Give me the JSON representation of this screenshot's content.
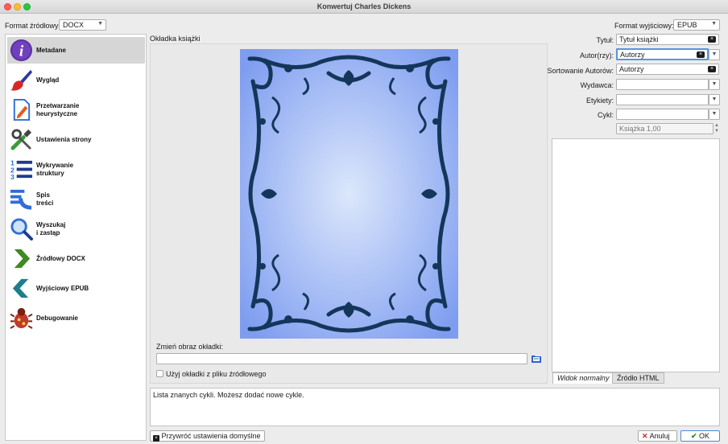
{
  "window": {
    "title": "Konwertuj Charles Dickens"
  },
  "source_format": {
    "label": "Format źródłowy:",
    "value": "DOCX"
  },
  "output_format": {
    "label": "Format wyjściowy:",
    "value": "EPUB"
  },
  "sidebar": {
    "items": [
      {
        "label": "Metadane",
        "icon": "info-icon",
        "active": true
      },
      {
        "label": "Wygląd",
        "icon": "paintbrush-icon"
      },
      {
        "label": "Przetwarzanie\nheurystyczne",
        "icon": "document-edit-icon"
      },
      {
        "label": "Ustawienia strony",
        "icon": "tools-icon"
      },
      {
        "label": "Wykrywanie\nstruktury",
        "icon": "numbered-list-icon"
      },
      {
        "label": "Spis\ntreści",
        "icon": "toc-icon"
      },
      {
        "label": "Wyszukaj\ni zastąp",
        "icon": "search-icon"
      },
      {
        "label": "Źródłowy DOCX",
        "icon": "chevron-right-icon"
      },
      {
        "label": "Wyjściowy EPUB",
        "icon": "chevron-left-icon"
      },
      {
        "label": "Debugowanie",
        "icon": "bug-icon"
      }
    ]
  },
  "cover": {
    "heading": "Okładka książki",
    "change_label": "Zmień obraz okładki:",
    "path_value": "",
    "use_source_label": "Użyj okładki z pliku źródłowego",
    "browse_icon": "folder-icon"
  },
  "metadata": {
    "title": {
      "label": "Tytuł:",
      "value": "Tytuł książki"
    },
    "authors": {
      "label": "Autor(rzy):",
      "value": "Autorzy"
    },
    "author_sort": {
      "label": "Sortowanie Autorów:",
      "value": "Autorzy"
    },
    "publisher": {
      "label": "Wydawca:",
      "value": ""
    },
    "tags": {
      "label": "Etykiety:",
      "value": ""
    },
    "series": {
      "label": "Cykl:",
      "value": ""
    },
    "series_index": {
      "placeholder": "Książka 1,00"
    }
  },
  "comments_tabs": {
    "normal": "Widok normalny",
    "html": "Źródło HTML"
  },
  "help_text": "Lista znanych cykli. Możesz dodać nowe cykle.",
  "buttons": {
    "restore_defaults": "Przywróć ustawienia domyślne",
    "cancel": "Anuluj",
    "ok": "OK"
  },
  "colors": {
    "accent": "#4d8bd8",
    "cover_bg": "#a9c0f5",
    "cover_frame": "#14365a"
  }
}
